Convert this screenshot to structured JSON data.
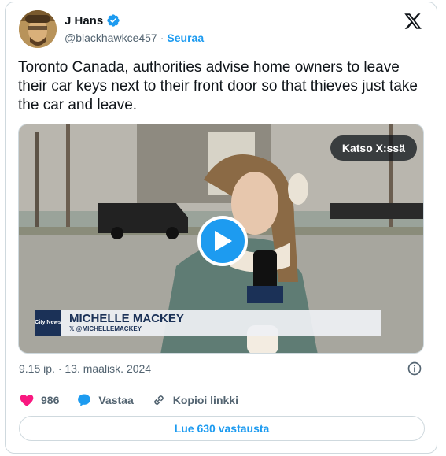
{
  "author": {
    "display_name": "J Hans",
    "handle": "@blackhawkce457",
    "separator": "·",
    "follow_label": "Seuraa"
  },
  "tweet": {
    "text": "Toronto Canada, authorities advise home owners to leave their car keys next to their front door so that thieves just take the car and leave.",
    "timestamp": "9.15 ip. · 13. maalisk. 2024"
  },
  "media": {
    "watch_label": "Katso X:ssä",
    "lower_third_logo": "City News",
    "lower_third_name": "MICHELLE MACKEY",
    "lower_third_handle": "𝕏 @MICHELLEMACKEY",
    "mic_flag": "CityNews"
  },
  "actions": {
    "like_count": "986",
    "reply_label": "Vastaa",
    "copy_label": "Kopioi linkki"
  },
  "read_replies_label": "Lue 630 vastausta",
  "colors": {
    "accent": "#1d9bf0",
    "like": "#f91880",
    "text": "#0f1419",
    "muted": "#536471",
    "border": "#cfd9de"
  },
  "icons": [
    "verified-badge-icon",
    "x-logo-icon",
    "play-icon",
    "info-icon",
    "heart-icon",
    "reply-bubble-icon",
    "link-icon"
  ]
}
